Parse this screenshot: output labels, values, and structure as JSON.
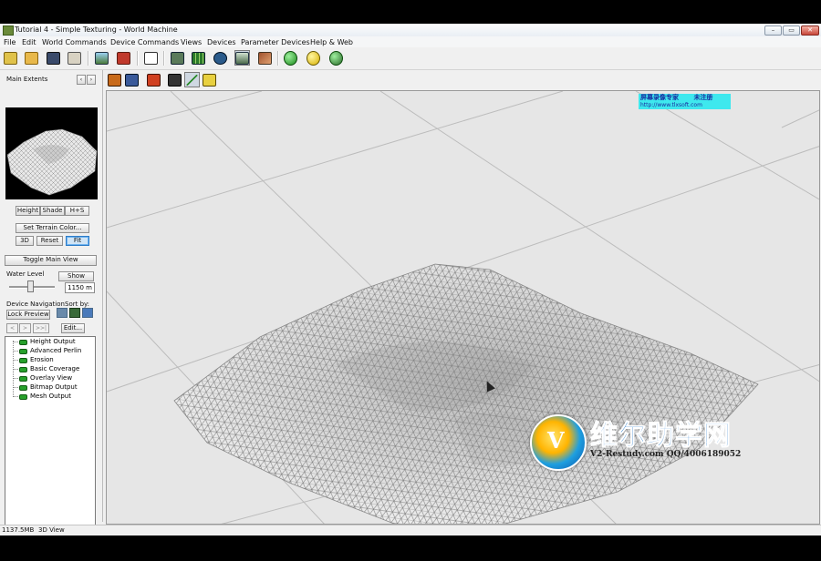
{
  "window": {
    "title": "Tutorial 4 - Simple Texturing - World Machine",
    "controls": [
      "–",
      "▭",
      "✕"
    ]
  },
  "menu": [
    "File",
    "Edit",
    "World Commands",
    "Device Commands",
    "Views",
    "Devices",
    "Parameter Devices",
    "Help & Web"
  ],
  "toolbar_icons": [
    "new-file-icon",
    "open-folder-icon",
    "save-icon",
    "wizard-icon",
    "terrain-view-icon",
    "device-icon",
    "dice-icon",
    "layout-view-icon",
    "grid-view-icon",
    "explorer-icon",
    "3d-view-icon",
    "texture-icon",
    "build-green-icon",
    "build-yellow-icon",
    "build-globe-icon"
  ],
  "panel": {
    "header": "Main Extents",
    "header_buttons": [
      "‹",
      "›"
    ],
    "view_modes": [
      "Height",
      "Shade",
      "H+S"
    ],
    "set_color": "Set Terrain Color...",
    "view_ctrls": [
      "3D",
      "Reset",
      "Fit"
    ],
    "toggle_main": "Toggle Main View",
    "water_label": "Water Level",
    "water_show": "Show",
    "water_value": "1150 m",
    "nav_label": "Device Navigation",
    "sort_label": "Sort by:",
    "lock_preview": "Lock Preview",
    "nav_buttons": [
      "<",
      ">",
      ">>|"
    ],
    "edit": "Edit...",
    "devices": [
      "Height Output",
      "Advanced Perlin",
      "Erosion",
      "Basic Coverage",
      "Overlay View",
      "Bitmap Output",
      "Mesh Output"
    ]
  },
  "view_toolbar": [
    "render-icon",
    "camera-icon",
    "object-icon",
    "box-icon",
    "line-icon",
    "help-icon"
  ],
  "watermark_top": {
    "line1": "屏幕录像专家",
    "line1b": "未注册",
    "line2": "http://www.tlxsoft.com"
  },
  "watermark_brand": {
    "cn": "维尔助学网",
    "en": "V2-Restudy.com QQ/4006189052"
  },
  "status": {
    "memory": "1137.5MB",
    "view": "3D View"
  },
  "colors": {
    "accent": "#2c7bc7",
    "device_pill": "#27a02b",
    "viewport": "#e6e6e6"
  }
}
